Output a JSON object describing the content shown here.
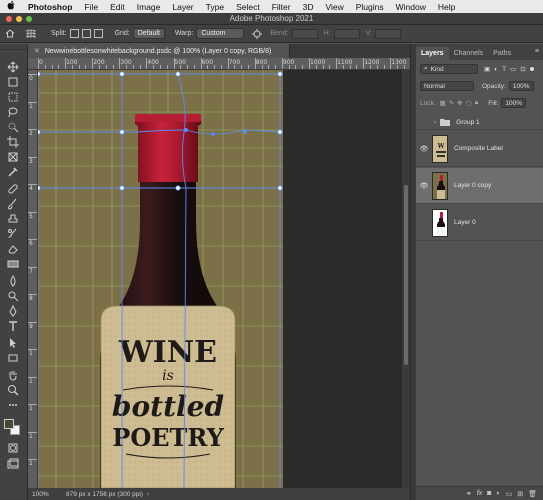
{
  "menubar": {
    "apple": "",
    "items": [
      "Photoshop",
      "File",
      "Edit",
      "Image",
      "Layer",
      "Type",
      "Select",
      "Filter",
      "3D",
      "View",
      "Plugins",
      "Window",
      "Help"
    ]
  },
  "window": {
    "title": "Adobe Photoshop 2021"
  },
  "options": {
    "split_label": "Split:",
    "grid_label": "Grid:",
    "grid_value": "Default",
    "warp_label": "Warp:",
    "warp_value": "Custom",
    "bend_label": "Bend:",
    "h_label": "H:",
    "v_label": "V:"
  },
  "document": {
    "tab_title": "Newwinebottlesonwhitebackground.psdc @ 100% (Layer 0 copy, RGB/8)",
    "close_glyph": "✕"
  },
  "rulers": {
    "top_labels": [
      "0",
      "100",
      "200",
      "300",
      "400",
      "500",
      "600",
      "700",
      "800",
      "900",
      "1000",
      "1100",
      "1200",
      "1300"
    ],
    "left_labels": [
      "0",
      "1",
      "2",
      "3",
      "4",
      "5",
      "6",
      "7",
      "8",
      "9",
      "1",
      "1",
      "1",
      "1",
      "1",
      "1"
    ]
  },
  "artwork": {
    "label_lines": [
      "WINE",
      "is",
      "bottled",
      "POETRY"
    ]
  },
  "status": {
    "zoom": "100%",
    "dimensions": "879 px x 1756 px (300 ppi)"
  },
  "layers_panel": {
    "tabs": [
      "Layers",
      "Channels",
      "Paths"
    ],
    "menu_glyph": "≡",
    "kind_placeholder": "Kind",
    "blend_mode": "Normal",
    "opacity_label": "Opacity:",
    "opacity_value": "100%",
    "lock_label": "Lock:",
    "fill_label": "Fill:",
    "fill_value": "100%",
    "layers": [
      {
        "name": "Group 1",
        "type": "group",
        "visible": false,
        "selected": false
      },
      {
        "name": "Composite Label",
        "type": "layer",
        "visible": true,
        "selected": false
      },
      {
        "name": "Layer 0 copy",
        "type": "layer",
        "visible": true,
        "selected": true
      },
      {
        "name": "Layer 0",
        "type": "layer",
        "visible": false,
        "selected": false
      }
    ],
    "footer_icons": [
      "link-icon",
      "fx-icon",
      "mask-icon",
      "adjustment-icon",
      "folder-icon",
      "new-layer-icon",
      "trash-icon"
    ]
  },
  "colors": {
    "foreground": "#4b4636",
    "background": "#f3f3f3",
    "artboard": "#7c7048",
    "warp_grid": "#9bbf6a",
    "warp_handles": "#5b8cf0"
  }
}
